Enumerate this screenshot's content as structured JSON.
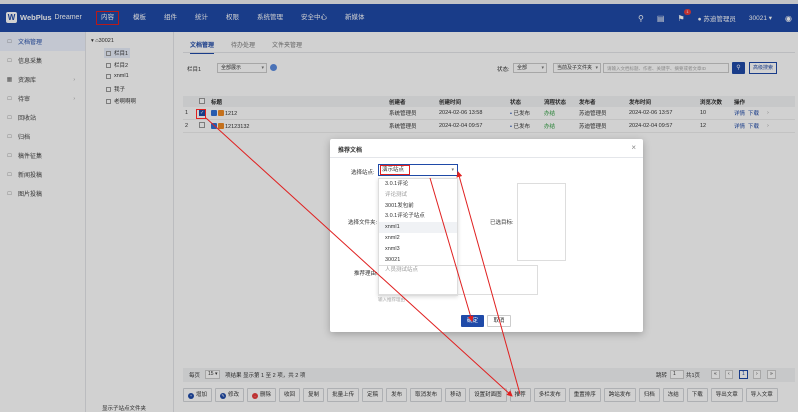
{
  "header": {
    "logo_text": "WebPlus",
    "logo_sub": "Dreamer",
    "nav": [
      "内容",
      "模板",
      "组件",
      "统计",
      "权限",
      "系统管理",
      "安全中心",
      "新媒体"
    ],
    "notify_count": "1",
    "user_name": "苏迪管理员",
    "site_id": "30021"
  },
  "sidebar": {
    "items": [
      {
        "label": "文档管理",
        "icon": "doc-icon"
      },
      {
        "label": "信息采集",
        "icon": "collect-icon"
      },
      {
        "label": "资源库",
        "icon": "resource-icon"
      },
      {
        "label": "待审",
        "icon": "review-icon"
      },
      {
        "label": "回收站",
        "icon": "trash-icon"
      },
      {
        "label": "归档",
        "icon": "archive-icon"
      },
      {
        "label": "稿件征集",
        "icon": "manuscript-icon"
      },
      {
        "label": "新闻投稿",
        "icon": "news-icon"
      },
      {
        "label": "图片投稿",
        "icon": "image-icon"
      }
    ]
  },
  "tree": {
    "root": "30021",
    "nodes": [
      "栏目1",
      "栏目2",
      "xnml1",
      "我子",
      "老啊啊啊"
    ],
    "footer": "显示子站点文件夹"
  },
  "tabs": [
    "文档管理",
    "待办处理",
    "文件夹管理"
  ],
  "filters": {
    "column_label": "栏目1",
    "display_value": "全部展示",
    "status_label": "状态:",
    "status_value": "全部",
    "scope_value": "当前及子文件夹",
    "search_placeholder": "请输入文档标题、作者、关键字、摘要或者文章ID",
    "advanced_label": "高级搜索"
  },
  "table": {
    "headers": [
      "标题",
      "创建者",
      "创建时间",
      "状态",
      "流程状态",
      "发布者",
      "发布时间",
      "浏览次数",
      "操作"
    ],
    "rows": [
      {
        "num": "1",
        "title": "1212",
        "creator": "系统管理员",
        "created": "2024-02-06 13:58",
        "status": "已发布",
        "flow": "办结",
        "publisher": "苏迪管理员",
        "published": "2024-02-06 13:57",
        "views": "10",
        "op1": "详情",
        "op2": "下载"
      },
      {
        "num": "2",
        "title": "12123132",
        "creator": "系统管理员",
        "created": "2024-02-04 09:57",
        "status": "已发布",
        "flow": "办结",
        "publisher": "苏迪管理员",
        "published": "2024-02-04 09:57",
        "views": "12",
        "op1": "详情",
        "op2": "下载"
      }
    ]
  },
  "pager": {
    "per_page_label": "每页",
    "per_page": "15",
    "summary": "项结果 显示第 1 至 2 项，共 2 项",
    "jump_label": "跳转",
    "jump_value": "1",
    "total_pages": "共1页",
    "current": "1"
  },
  "actions": [
    {
      "label": "增加",
      "color": "#1f4aa8"
    },
    {
      "label": "修改",
      "color": "#1f4aa8"
    },
    {
      "label": "删除",
      "color": "#e83e3e"
    },
    {
      "label": "收回"
    },
    {
      "label": "复制"
    },
    {
      "label": "批量上传"
    },
    {
      "label": "定稿"
    },
    {
      "label": "发布"
    },
    {
      "label": "取消发布"
    },
    {
      "label": "移动"
    },
    {
      "label": "设置封面图"
    },
    {
      "label": "推荐"
    },
    {
      "label": "多栏发布"
    },
    {
      "label": "重置排序"
    },
    {
      "label": "跨站发布"
    },
    {
      "label": "归档"
    },
    {
      "label": "冻结"
    },
    {
      "label": "下载"
    },
    {
      "label": "导出文章"
    },
    {
      "label": "导入文章"
    }
  ],
  "modal": {
    "title": "推荐文档",
    "site_label": "选择站点:",
    "site_value": "演示站点",
    "folder_label": "选择文件夹:",
    "target_label": "已选目标:",
    "reason_label": "推荐理由:",
    "note": "输入推荐理由",
    "ok": "确定",
    "cancel": "取消",
    "options": [
      "3.0.1评论",
      "评论测试",
      "3001发包前",
      "3.0.1评论子站点",
      "xnml1",
      "xnml2",
      "xnml3",
      "30021",
      "人员测试站点"
    ]
  },
  "colors": {
    "brand": "#1f4aa8",
    "annotation": "#e02020"
  }
}
